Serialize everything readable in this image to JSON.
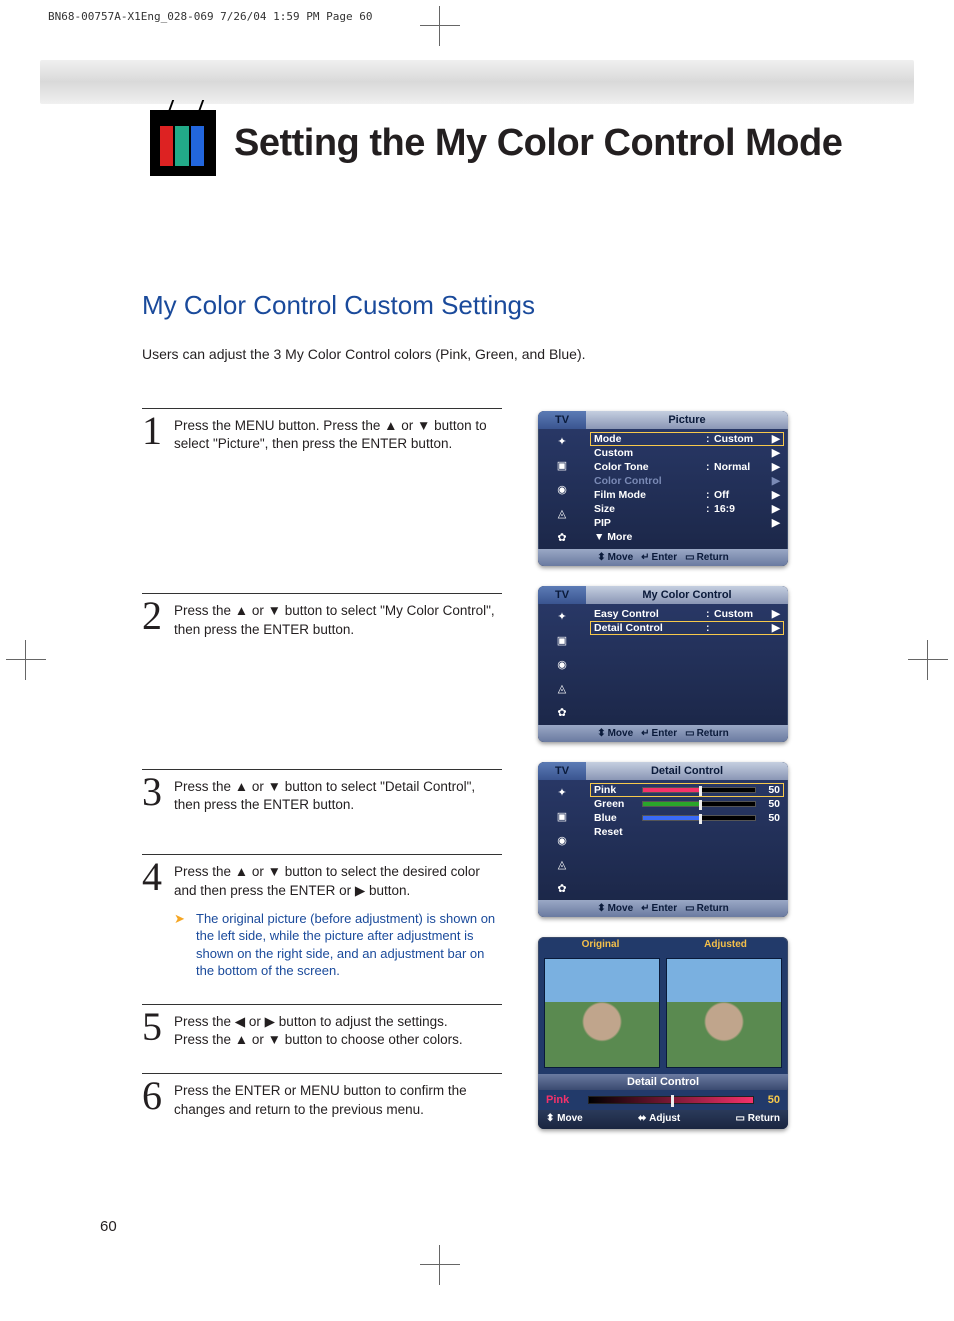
{
  "print_header": "BN68-00757A-X1Eng_028-069  7/26/04  1:59 PM  Page 60",
  "page_title": "Setting the My Color Control Mode",
  "subtitle": "My Color Control Custom Settings",
  "intro": "Users can adjust the 3 My Color Control colors (Pink, Green, and Blue).",
  "page_number": "60",
  "steps": [
    {
      "num": "1",
      "text": "Press the MENU button. Press the ▲ or ▼ button to select \"Picture\", then press the ENTER button."
    },
    {
      "num": "2",
      "text": "Press the ▲ or ▼ button to select \"My Color Control\", then press the ENTER button."
    },
    {
      "num": "3",
      "text": "Press the ▲ or ▼ button to select \"Detail Control\", then press the ENTER button."
    },
    {
      "num": "4",
      "text": "Press the ▲ or ▼ button to select the desired color and then press the ENTER or ▶ button.",
      "note": "The original picture (before adjustment) is shown on the left side, while the picture after adjustment is shown on the right side, and an adjustment bar on the bottom of the screen."
    },
    {
      "num": "5",
      "text": "Press the ◀ or ▶ button to adjust the settings.\nPress the ▲ or ▼ button to choose other colors."
    },
    {
      "num": "6",
      "text": "Press the ENTER or MENU button to confirm the changes and return to the previous menu."
    }
  ],
  "footer_hints": {
    "move": "Move",
    "enter": "Enter",
    "return": "Return",
    "adjust": "Adjust"
  },
  "osd_tv_label": "TV",
  "osd1": {
    "title": "Picture",
    "rows": [
      {
        "label": "Mode",
        "value": "Custom",
        "selected": true
      },
      {
        "label": "Custom",
        "value": ""
      },
      {
        "label": "Color Tone",
        "value": "Normal"
      },
      {
        "label": "Color Control",
        "value": "",
        "dim": true
      },
      {
        "label": "Film Mode",
        "value": "Off"
      },
      {
        "label": "Size",
        "value": "16:9"
      },
      {
        "label": "PIP",
        "value": ""
      },
      {
        "label": "▼ More",
        "value": "",
        "noarrow": true
      }
    ]
  },
  "osd2": {
    "title": "My Color Control",
    "rows": [
      {
        "label": "Easy Control",
        "value": "Custom"
      },
      {
        "label": "Detail Control",
        "value": "",
        "selected": true
      }
    ]
  },
  "osd3": {
    "title": "Detail Control",
    "sliders": [
      {
        "name": "Pink",
        "value": "50",
        "color": "#f5316a",
        "selected": true
      },
      {
        "name": "Green",
        "value": "50",
        "color": "#2aa52a"
      },
      {
        "name": "Blue",
        "value": "50",
        "color": "#3a6af5"
      }
    ],
    "reset": "Reset"
  },
  "osd4": {
    "original": "Original",
    "adjusted": "Adjusted",
    "title": "Detail Control",
    "slider_name": "Pink",
    "slider_value": "50"
  }
}
